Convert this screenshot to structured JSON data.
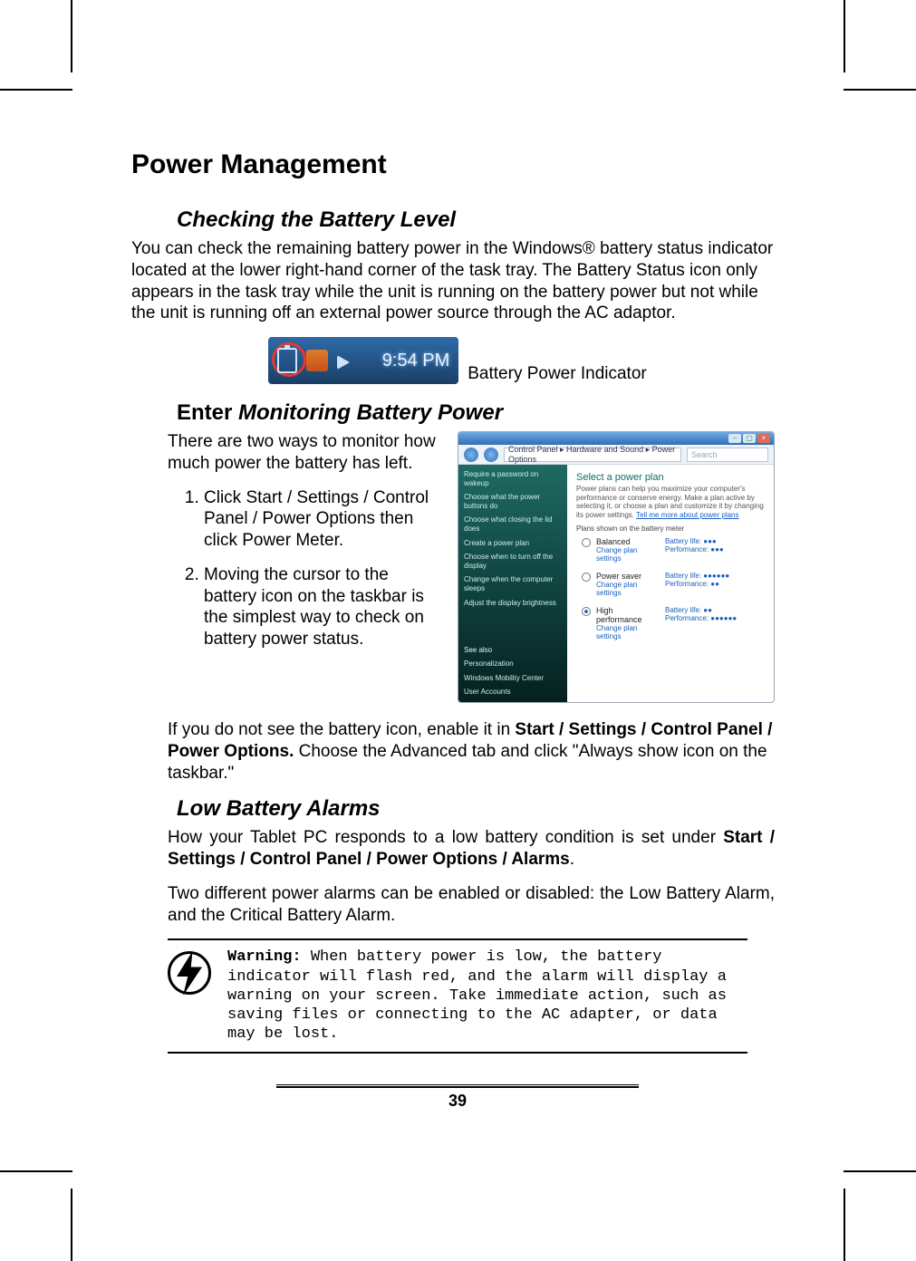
{
  "title": "Power Management",
  "section_checking": "Checking the Battery Level",
  "checking_para": "You can check the remaining battery power in the Windows® battery status indicator located at the lower right-hand corner of the task tray. The Battery Status icon only appears in the task tray while the unit is running on the battery power but not while the unit is running off an external power source through the AC adaptor.",
  "taskbar": {
    "time": "9:54 PM",
    "caption": "Battery Power Indicator"
  },
  "section_monitoring_prefix": "Enter ",
  "section_monitoring_ital": "Monitoring Battery Power",
  "monitoring_intro": "There are two ways to monitor how much power the battery has left.",
  "steps": [
    "Click Start / Settings / Control Panel / Power Options then click Power Meter.",
    "Moving the cursor to the battery icon on the taskbar is the simplest way to check on battery power status."
  ],
  "enable_note_pre": "If you do not see the battery icon, enable it in ",
  "enable_note_bold": "Start / Settings / Control Panel / Power Options.",
  "enable_note_post": " Choose the Advanced tab and click \"Always show icon on the taskbar.\"",
  "section_low": "Low Battery Alarms",
  "low_para1_pre": "How your Tablet PC responds to a low battery condition is set under ",
  "low_para1_bold": "Start / Settings / Control Panel / Power Options / Alarms",
  "low_para1_post": ".",
  "low_para2": "Two different power alarms can be enabled or disabled: the Low Battery Alarm, and the Critical Battery Alarm.",
  "warning_label": "Warning:",
  "warning_text": " When battery power is low, the battery indicator will flash red, and the alarm will display a warning on your screen. Take immediate action, such as saving files or connecting to the AC adapter, or data may be lost.",
  "page_number": "39",
  "power_options": {
    "breadcrumb": "Control Panel ▸ Hardware and Sound ▸ Power Options",
    "search_placeholder": "Search",
    "sidebar": {
      "items": [
        "Require a password on wakeup",
        "Choose what the power buttons do",
        "Choose what closing the lid does",
        "Create a power plan",
        "Choose when to turn off the display",
        "Change when the computer sleeps",
        "Adjust the display brightness"
      ],
      "see_also": "See also",
      "see_also_items": [
        "Personalization",
        "Windows Mobility Center",
        "User Accounts"
      ]
    },
    "heading": "Select a power plan",
    "description": "Power plans can help you maximize your computer's performance or conserve energy. Make a plan active by selecting it, or choose a plan and customize it by changing its power settings. ",
    "description_link": "Tell me more about power plans",
    "subheading": "Plans shown on the battery meter",
    "change_link": "Change plan settings",
    "plans": [
      {
        "name": "Balanced",
        "checked": false,
        "battery": "Battery life: ●●●",
        "perf": "Performance: ●●●"
      },
      {
        "name": "Power saver",
        "checked": false,
        "battery": "Battery life: ●●●●●●",
        "perf": "Performance: ●●"
      },
      {
        "name": "High performance",
        "checked": true,
        "battery": "Battery life: ●●",
        "perf": "Performance: ●●●●●●"
      }
    ]
  }
}
